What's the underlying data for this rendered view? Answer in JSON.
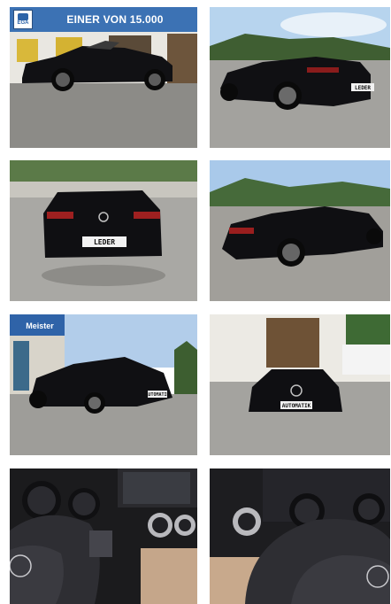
{
  "gallery": {
    "banner": {
      "logo_text": "EGA",
      "text": "EINER VON 15.000"
    },
    "photos": [
      {
        "description": "Black convertible side view in front of dealership"
      },
      {
        "description": "Black convertible rear three-quarter view"
      },
      {
        "description": "Black convertible rear view"
      },
      {
        "description": "Black convertible rear side view"
      },
      {
        "description": "Black convertible front three-quarter view",
        "sign_text": "Meister"
      },
      {
        "description": "Black convertible front view"
      },
      {
        "description": "Interior instrument cluster and steering wheel"
      },
      {
        "description": "Interior steering wheel and dashboard"
      }
    ],
    "plates": {
      "photo2": "LEDER",
      "photo3": "LEDER",
      "photo5": "AUTOMATIK",
      "photo6": "AUTOMATIK"
    }
  }
}
